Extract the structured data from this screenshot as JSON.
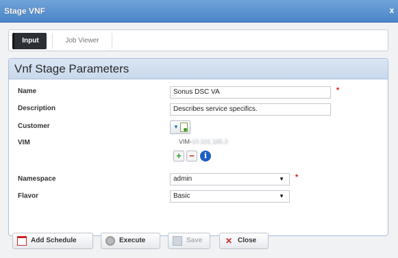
{
  "window": {
    "title": "Stage VNF",
    "close_glyph": "x"
  },
  "tabs": [
    {
      "label": "Input",
      "active": true
    },
    {
      "label": "Job Viewer",
      "active": false
    }
  ],
  "panel": {
    "title": "Vnf Stage Parameters"
  },
  "form": {
    "name": {
      "label": "Name",
      "value": "Sonus DSC VA",
      "required": true
    },
    "description": {
      "label": "Description",
      "value": "Describes service specifics."
    },
    "customer": {
      "label": "Customer",
      "icon": "customer-picker-icon"
    },
    "vim": {
      "label": "VIM",
      "value": "VIM-10.101.165.3",
      "prefix": "VIM-",
      "blurred_suffix": "10.101.165.3"
    },
    "namespace": {
      "label": "Namespace",
      "value": "admin",
      "required": true
    },
    "flavor": {
      "label": "Flavor",
      "value": "Basic"
    }
  },
  "colors": {
    "title_bar": "#4b86c8",
    "panel_header": "#c8d8ec",
    "required": "#dd1111",
    "active_tab": "#2b2f36"
  },
  "buttons": {
    "add_schedule": "Add Schedule",
    "execute": "Execute",
    "save": "Save",
    "close": "Close"
  }
}
